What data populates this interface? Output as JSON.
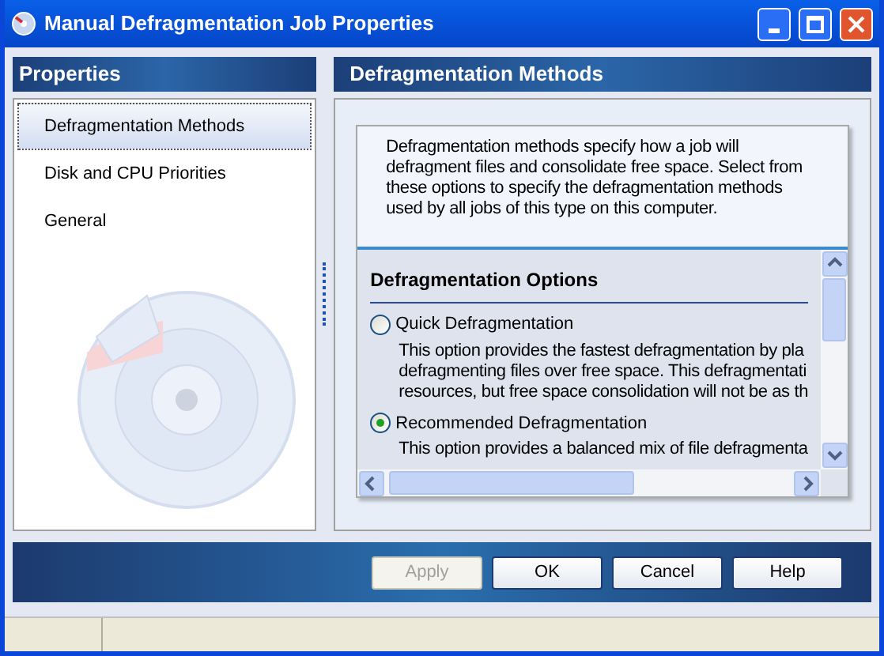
{
  "window": {
    "title": "Manual Defragmentation Job Properties"
  },
  "sidebar": {
    "header": "Properties",
    "items": [
      {
        "label": "Defragmentation Methods",
        "selected": true
      },
      {
        "label": "Disk and CPU Priorities",
        "selected": false
      },
      {
        "label": "General",
        "selected": false
      }
    ]
  },
  "content": {
    "header": "Defragmentation Methods",
    "description": "Defragmentation methods specify how a job will\ndefragment files and consolidate free space. Select from\nthese options to specify the defragmentation methods\nused by all jobs of this type on this computer.",
    "section_title": "Defragmentation Options",
    "options": [
      {
        "label": "Quick Defragmentation",
        "selected": false,
        "description": "This option provides the fastest defragmentation by pla\ndefragmenting files over free space. This defragmentati\nresources, but free space consolidation will not be as th"
      },
      {
        "label": "Recommended Defragmentation",
        "selected": true,
        "description": "This option provides a balanced mix of file defragmenta"
      }
    ]
  },
  "buttons": [
    {
      "label": "Apply",
      "disabled": true
    },
    {
      "label": "OK",
      "disabled": false
    },
    {
      "label": "Cancel",
      "disabled": false
    },
    {
      "label": "Help",
      "disabled": false
    }
  ]
}
